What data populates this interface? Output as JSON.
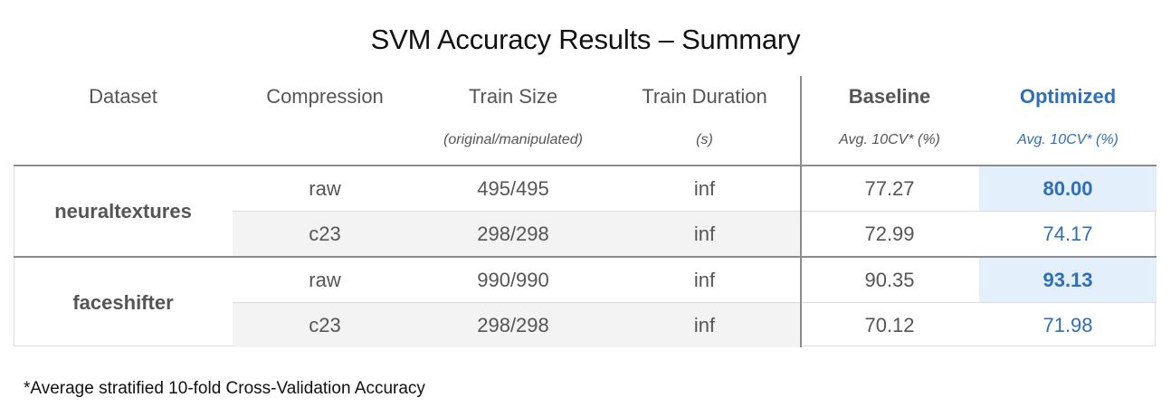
{
  "title": "SVM Accuracy Results – Summary",
  "chart_data": {
    "type": "table",
    "title": "SVM Accuracy Results – Summary",
    "columns": [
      "Dataset",
      "Compression",
      "Train Size",
      "Train Duration",
      "Baseline",
      "Optimized"
    ],
    "subheaders": [
      "",
      "",
      "(original/manipulated)",
      "(s)",
      "Avg. 10CV* (%)",
      "Avg. 10CV* (%)"
    ],
    "groups": [
      {
        "dataset": "neuraltextures",
        "rows": [
          {
            "compression": "raw",
            "train_size": "495/495",
            "train_duration": "inf",
            "baseline": "77.27",
            "optimized": "80.00",
            "highlight": true
          },
          {
            "compression": "c23",
            "train_size": "298/298",
            "train_duration": "inf",
            "baseline": "72.99",
            "optimized": "74.17",
            "highlight": false
          }
        ]
      },
      {
        "dataset": "faceshifter",
        "rows": [
          {
            "compression": "raw",
            "train_size": "990/990",
            "train_duration": "inf",
            "baseline": "90.35",
            "optimized": "93.13",
            "highlight": true
          },
          {
            "compression": "c23",
            "train_size": "298/298",
            "train_duration": "inf",
            "baseline": "70.12",
            "optimized": "71.98",
            "highlight": false
          }
        ]
      }
    ],
    "footnote": "*Average stratified 10-fold Cross-Validation Accuracy"
  },
  "colors": {
    "optimized_text": "#2e6fb7",
    "highlight_fill": "#e3effb",
    "shaded_row": "#f3f3f3",
    "separator": "#8c8c8c"
  }
}
